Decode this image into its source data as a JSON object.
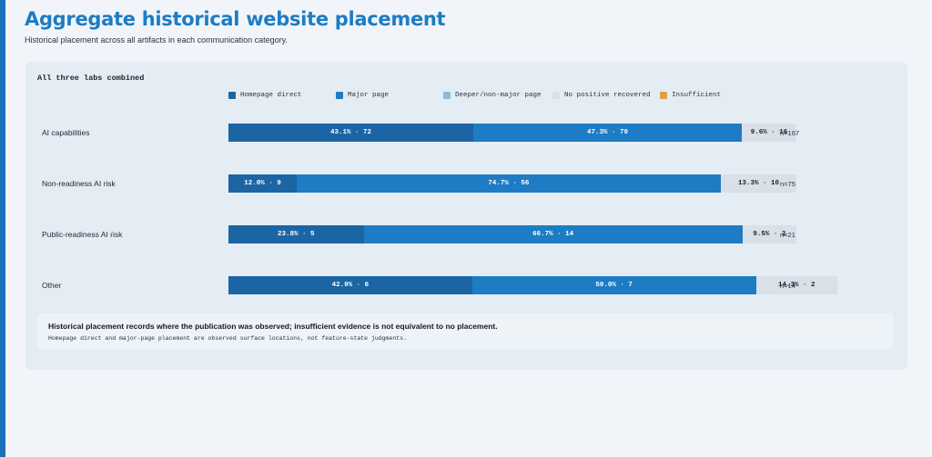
{
  "header": {
    "title": "Aggregate historical website placement",
    "subtitle": "Historical placement across all artifacts in each communication category."
  },
  "panel": {
    "title": "All three labs combined"
  },
  "colors": {
    "homepage_direct": "#1b65a4",
    "major_page": "#1d7cc4",
    "deeper": "#8dbbd8",
    "no_positive": "#d9e0e8",
    "insufficient": "#e0a040"
  },
  "chart_data": {
    "type": "bar",
    "orientation": "horizontal",
    "stacked": true,
    "title": "All three labs combined",
    "xlim": [
      0,
      100
    ],
    "legend_position": "top",
    "legend": [
      {
        "name": "Homepage direct",
        "color": "#1b65a4"
      },
      {
        "name": "Major page",
        "color": "#1d7cc4"
      },
      {
        "name": "Deeper/non-major page",
        "color": "#8dbbd8"
      },
      {
        "name": "No positive recovered",
        "color": "#d9e0e8"
      },
      {
        "name": "Insufficient",
        "color": "#e0a040"
      }
    ],
    "rows": [
      {
        "category": "AI capabilities",
        "n_label": "n=167",
        "segments": [
          {
            "series": "Homepage direct",
            "percent": 43.1,
            "count": 72,
            "label": "43.1% · 72"
          },
          {
            "series": "Major page",
            "percent": 47.3,
            "count": 79,
            "label": "47.3% · 79"
          },
          {
            "series": "No positive recovered",
            "percent": 9.6,
            "count": 16,
            "label": "9.6% · 16"
          }
        ]
      },
      {
        "category": "Non-readiness AI risk",
        "n_label": "n=75",
        "segments": [
          {
            "series": "Homepage direct",
            "percent": 12.0,
            "count": 9,
            "label": "12.0% · 9"
          },
          {
            "series": "Major page",
            "percent": 74.7,
            "count": 56,
            "label": "74.7% · 56"
          },
          {
            "series": "No positive recovered",
            "percent": 13.3,
            "count": 10,
            "label": "13.3% · 10"
          }
        ]
      },
      {
        "category": "Public-readiness AI risk",
        "n_label": "n=21",
        "segments": [
          {
            "series": "Homepage direct",
            "percent": 23.8,
            "count": 5,
            "label": "23.8% · 5"
          },
          {
            "series": "Major page",
            "percent": 66.7,
            "count": 14,
            "label": "66.7% · 14"
          },
          {
            "series": "No positive recovered",
            "percent": 9.5,
            "count": 2,
            "label": "9.5% · 2"
          }
        ]
      },
      {
        "category": "Other",
        "n_label": "n=14",
        "segments": [
          {
            "series": "Homepage direct",
            "percent": 42.9,
            "count": 6,
            "label": "42.9% · 6"
          },
          {
            "series": "Major page",
            "percent": 50.0,
            "count": 7,
            "label": "50.0% · 7"
          },
          {
            "series": "No positive recovered",
            "percent": 14.3,
            "count": 2,
            "label": "14.3% · 2"
          }
        ]
      }
    ]
  },
  "note": {
    "main": "Historical placement records where the publication was observed; insufficient evidence is not equivalent to no placement.",
    "sub": "Homepage direct and major-page placement are observed surface locations, not feature-state judgments."
  }
}
